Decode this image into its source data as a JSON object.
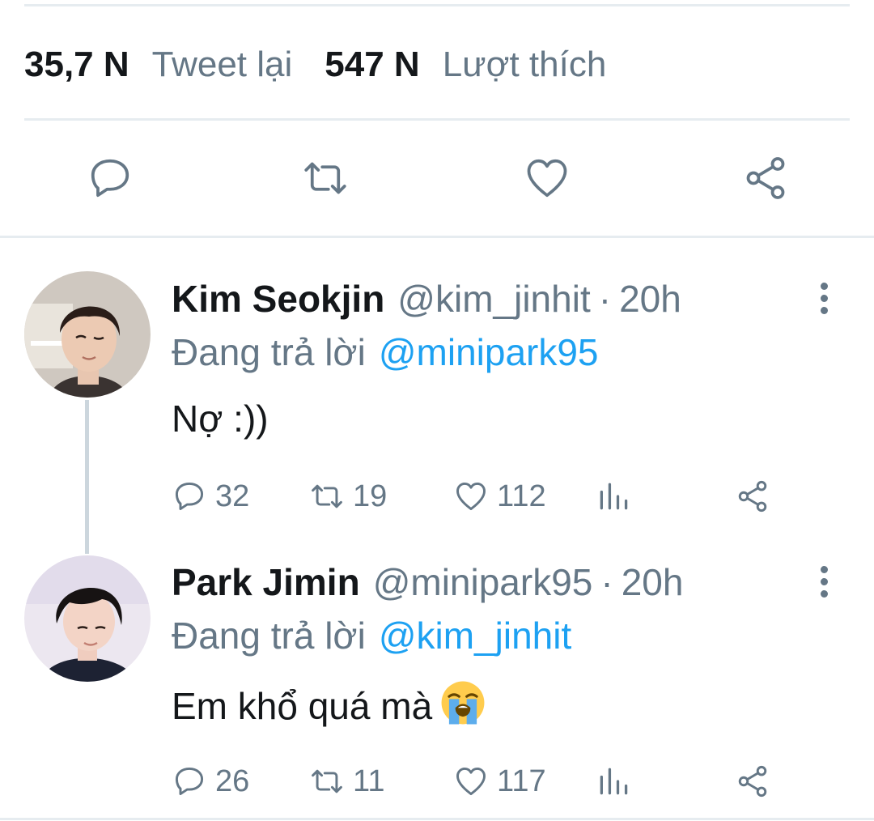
{
  "tweet_stats": {
    "retweets_count": "35,7 N",
    "retweets_label": "Tweet lại",
    "likes_count": "547 N",
    "likes_label": "Lượt thích"
  },
  "main_actions": {
    "icons": [
      "reply-icon",
      "retweet-icon",
      "like-icon",
      "share-icon"
    ]
  },
  "replies": [
    {
      "name": "Kim Seokjin",
      "handle": "@kim_jinhit",
      "separator": "·",
      "time": "20h",
      "replying_to_label": "Đang trả lời",
      "replying_to_handle": "@minipark95",
      "text": "Nợ :))",
      "reply_count": "32",
      "retweet_count": "19",
      "like_count": "112"
    },
    {
      "name": "Park Jimin",
      "handle": "@minipark95",
      "separator": "·",
      "time": "20h",
      "replying_to_label": "Đang trả lời",
      "replying_to_handle": "@kim_jinhit",
      "text": "Em khổ quá mà",
      "emoji": "loudly-crying-face",
      "reply_count": "26",
      "retweet_count": "11",
      "like_count": "117"
    }
  ],
  "colors": {
    "text_primary": "#14171a",
    "text_secondary": "#657786",
    "link": "#1da1f2",
    "divider": "#e6ecf0",
    "thread_line": "#ccd6dd"
  }
}
